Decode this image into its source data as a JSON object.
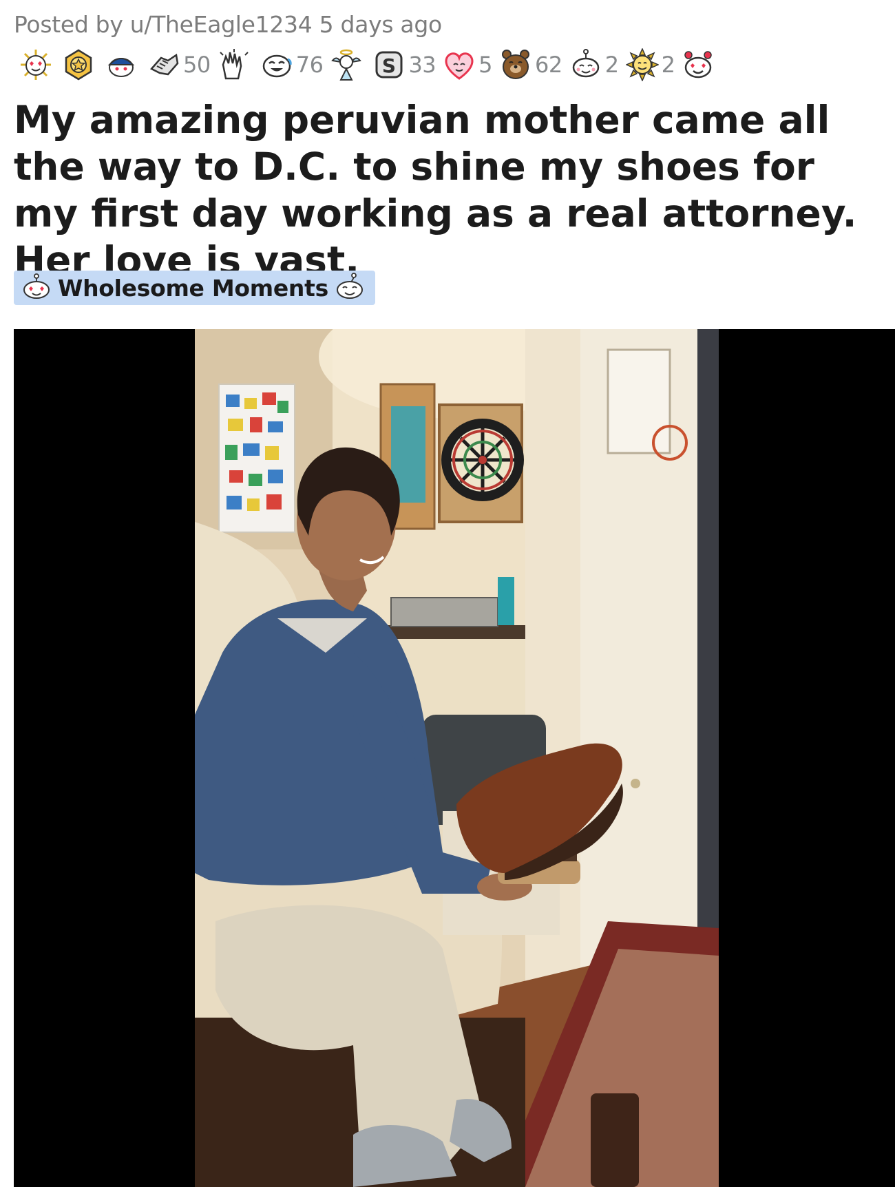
{
  "post": {
    "posted_by_prefix": "Posted by",
    "username": "u/TheEagle1234",
    "age": "5 days ago",
    "title": "My amazing peruvian mother came all the way to D.C. to shine my shoes for my first day working as a real attorney. Her love is vast.",
    "flair": {
      "label": "Wholesome Moments",
      "background": "#c5daf5"
    }
  },
  "awards": [
    {
      "icon": "heart-eyes-award-icon",
      "count": ""
    },
    {
      "icon": "gold-medal-award-icon",
      "count": ""
    },
    {
      "icon": "silver-snoo-award-icon",
      "count": ""
    },
    {
      "icon": "take-my-power-award-icon",
      "count": "50"
    },
    {
      "icon": "clapping-hands-award-icon",
      "count": ""
    },
    {
      "icon": "laughing-snoo-award-icon",
      "count": "76"
    },
    {
      "icon": "angel-award-icon",
      "count": ""
    },
    {
      "icon": "s-coin-award-icon",
      "count": "33"
    },
    {
      "icon": "love-heart-award-icon",
      "count": "5"
    },
    {
      "icon": "bear-hug-award-icon",
      "count": "62"
    },
    {
      "icon": "wholesome-snoo-award-icon",
      "count": "2"
    },
    {
      "icon": "sun-award-icon",
      "count": "2"
    },
    {
      "icon": "heart-eyes-snoo-award-icon",
      "count": ""
    }
  ],
  "colors": {
    "meta_text": "#7c7c7c",
    "title_text": "#1c1c1c",
    "media_background": "#000000"
  }
}
